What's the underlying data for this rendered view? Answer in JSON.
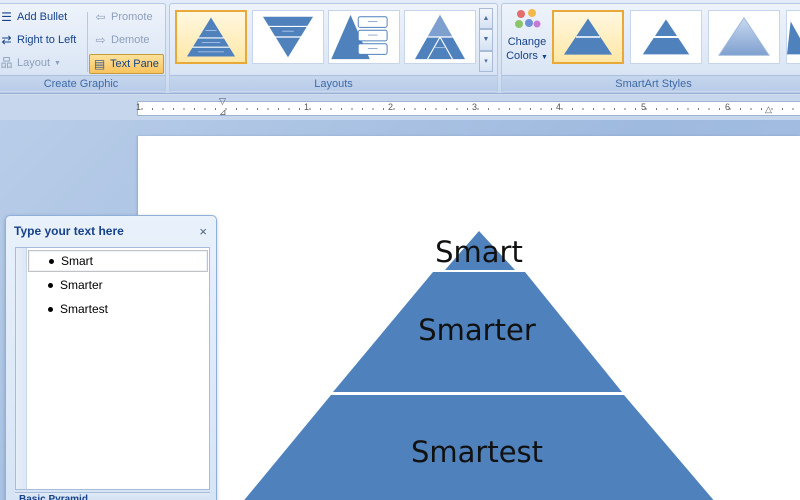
{
  "create_graphic": {
    "add_bullet": "Add Bullet",
    "right_to_left": "Right to Left",
    "layout": "Layout",
    "promote": "Promote",
    "demote": "Demote",
    "text_pane": "Text Pane",
    "group_label": "Create Graphic"
  },
  "layouts": {
    "group_label": "Layouts"
  },
  "smartart_styles": {
    "change_colors_line1": "Change",
    "change_colors_line2": "Colors",
    "group_label": "SmartArt Styles"
  },
  "ruler": {
    "numbers": [
      "1",
      "1",
      "2",
      "3",
      "4",
      "5",
      "6"
    ]
  },
  "text_pane": {
    "title": "Type your text here",
    "close": "×",
    "items": [
      "Smart",
      "Smarter",
      "Smartest"
    ],
    "footer": "Basic Pyramid"
  },
  "pyramid": {
    "levels": [
      "Smart",
      "Smarter",
      "Smartest"
    ],
    "fill_color": "#4f81bd"
  },
  "colors": {
    "accent_blue": "#4f81bd",
    "ribbon_text": "#15428b",
    "selected_gallery_border": "#e8a93a"
  }
}
